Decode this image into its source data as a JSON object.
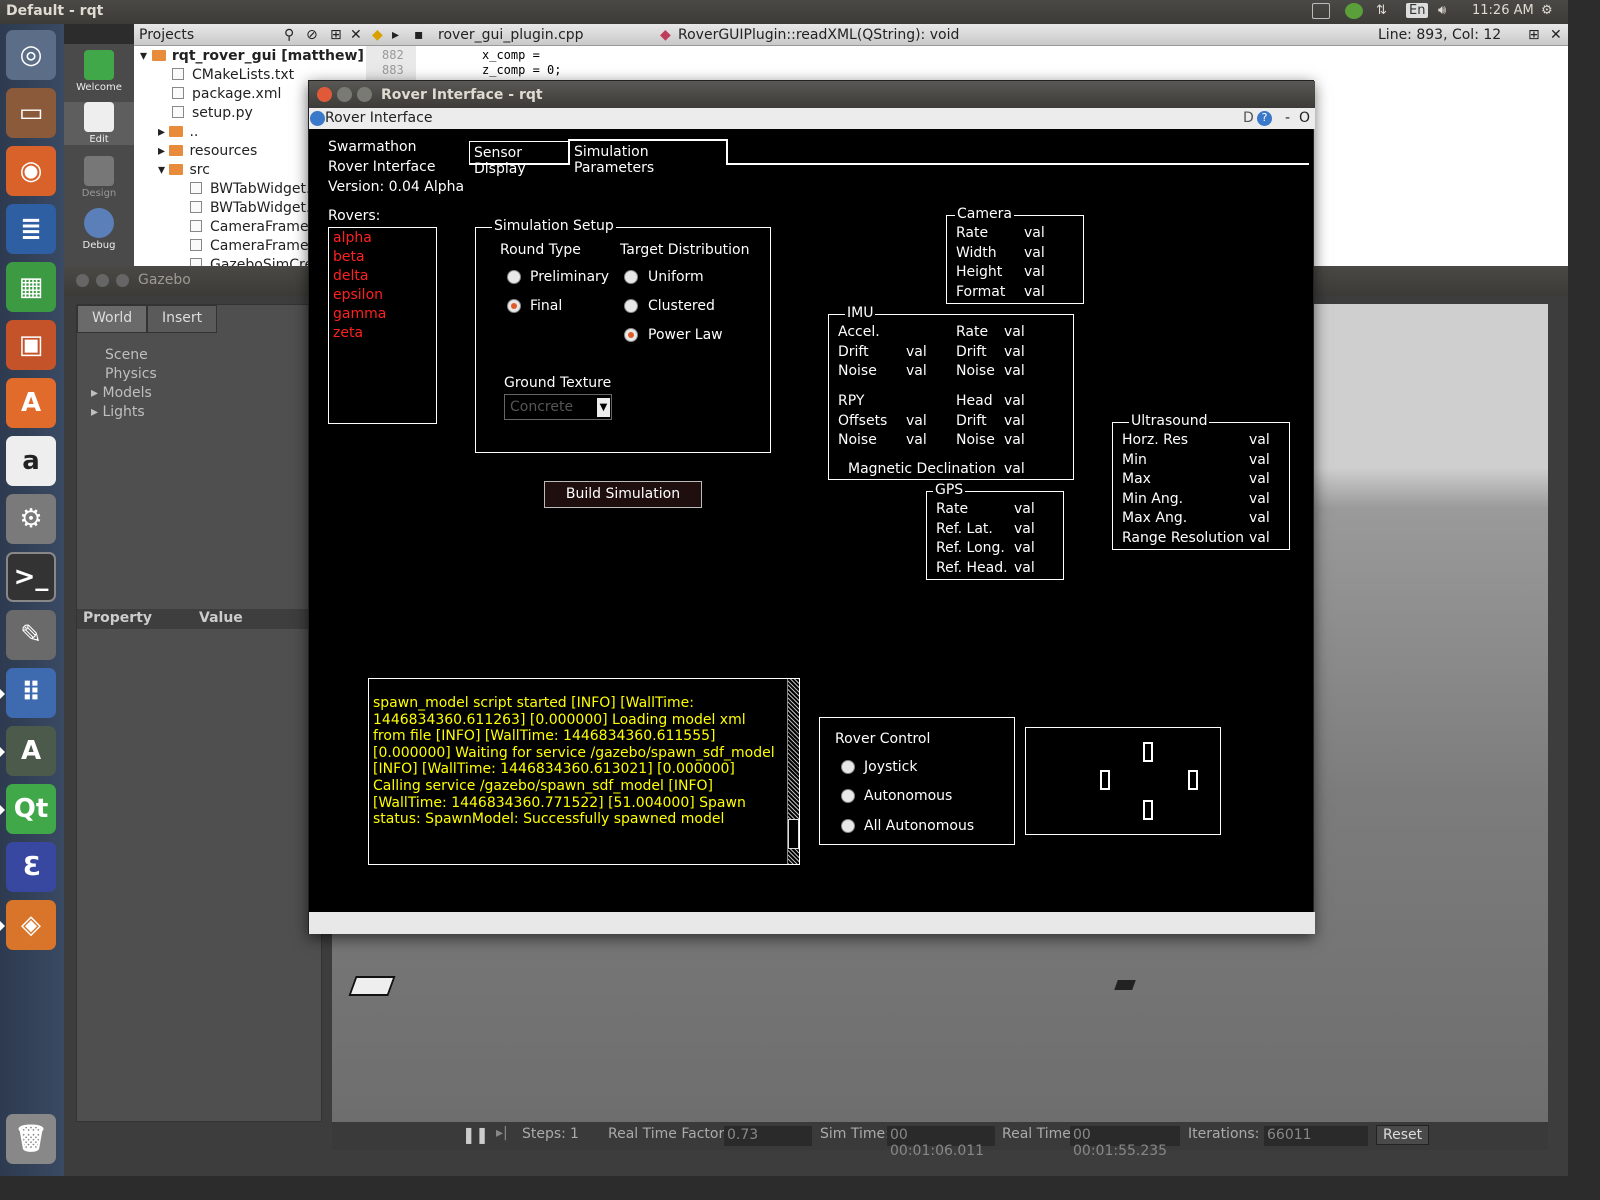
{
  "topbar": {
    "title": "Default - rqt",
    "lang": "En",
    "time": "11:26 AM"
  },
  "qtcreator": {
    "modes": [
      "Welcome",
      "Edit",
      "Design",
      "Debug"
    ],
    "projects_label": "Projects",
    "open_file": "rover_gui_plugin.cpp",
    "function": "RoverGUIPlugin::readXML(QString): void",
    "position": "Line: 893, Col: 12",
    "tree": [
      {
        "label": "rqt_rover_gui [matthew]"
      },
      {
        "label": "CMakeLists.txt"
      },
      {
        "label": "package.xml"
      },
      {
        "label": "setup.py"
      },
      {
        "label": ".."
      },
      {
        "label": "resources"
      },
      {
        "label": "src"
      },
      {
        "label": "BWTabWidget."
      },
      {
        "label": "BWTabWidget."
      },
      {
        "label": "CameraFrame."
      },
      {
        "label": "CameraFrame."
      },
      {
        "label": "GazeboSimCre"
      }
    ],
    "code": [
      {
        "line": "882",
        "text": "x_comp ="
      },
      {
        "line": "883",
        "text": "z_comp = 0;"
      }
    ]
  },
  "gazebo": {
    "title": "Gazebo",
    "tabs": [
      "World",
      "Insert"
    ],
    "tree": [
      "Scene",
      "Physics",
      "Models",
      "Lights"
    ],
    "prop_header": "Property",
    "value_header": "Value",
    "steps_label": "Steps:",
    "steps_value": "1",
    "rtf_label": "Real Time Factor:",
    "rtf_value": "0.73",
    "simtime_label": "Sim Time:",
    "simtime_value": "00 00:01:06.011",
    "realtime_label": "Real Time:",
    "realtime_value": "00 00:01:55.235",
    "iter_label": "Iterations:",
    "iter_value": "66011",
    "reset_label": "Reset"
  },
  "rqt": {
    "window_title": "Rover Interface - rqt",
    "dock_title": "Rover Interface",
    "dock_buttons": {
      "d": "D",
      "help": "?",
      "min": "-",
      "close": "O"
    },
    "app_name_1": "Swarmathon",
    "app_name_2": "Rover Interface",
    "version": "Version:  0.04 Alpha",
    "tabs": [
      "Sensor Display",
      "Simulation Parameters"
    ],
    "rovers_label": "Rovers:",
    "rovers": [
      "alpha",
      "beta",
      "delta",
      "epsilon",
      "gamma",
      "zeta"
    ],
    "sim_setup": {
      "title": "Simulation Setup",
      "round_type_label": "Round Type",
      "round_types": [
        "Preliminary",
        "Final"
      ],
      "round_selected": "Final",
      "target_label": "Target Distribution",
      "targets": [
        "Uniform",
        "Clustered",
        "Power Law"
      ],
      "target_selected": "Power Law",
      "ground_label": "Ground Texture",
      "ground_value": "Concrete"
    },
    "build_button": "Build Simulation",
    "camera": {
      "title": "Camera",
      "rows": [
        [
          "Rate",
          "val"
        ],
        [
          "Width",
          "val"
        ],
        [
          "Height",
          "val"
        ],
        [
          "Format",
          "val"
        ]
      ]
    },
    "imu": {
      "title": "IMU",
      "accel": "Accel.",
      "drift": "Drift",
      "noise": "Noise",
      "rpy": "RPY",
      "offsets": "Offsets",
      "rate": "Rate",
      "head": "Head",
      "mag": "Magnetic Declination",
      "val": "val"
    },
    "gps": {
      "title": "GPS",
      "rows": [
        [
          "Rate",
          "val"
        ],
        [
          "Ref. Lat.",
          "val"
        ],
        [
          "Ref. Long.",
          "val"
        ],
        [
          "Ref. Head.",
          "val"
        ]
      ]
    },
    "ultrasound": {
      "title": "Ultrasound",
      "rows": [
        [
          "Horz. Res",
          "val"
        ],
        [
          "Min",
          "val"
        ],
        [
          "Max",
          "val"
        ],
        [
          "Min Ang.",
          "val"
        ],
        [
          "Max Ang.",
          "val"
        ],
        [
          "Range Resolution",
          "val"
        ]
      ]
    },
    "log_text": "spawn_model script started [INFO] [WallTime: 1446834360.611263] [0.000000] Loading model xml from file [INFO] [WallTime: 1446834360.611555] [0.000000] Waiting for service /gazebo/spawn_sdf_model [INFO] [WallTime: 1446834360.613021] [0.000000] Calling service /gazebo/spawn_sdf_model [INFO] [WallTime: 1446834360.771522] [51.004000] Spawn status: SpawnModel: Successfully spawned model",
    "rover_control": {
      "title": "Rover Control",
      "options": [
        "Joystick",
        "Autonomous",
        "All Autonomous"
      ]
    }
  },
  "colors": {
    "rover_name": "#ff2020",
    "log_text": "#ffff00",
    "radio_selected": "#e05a2a",
    "canvas_bg": "#000000"
  }
}
